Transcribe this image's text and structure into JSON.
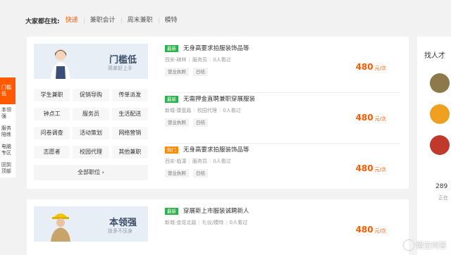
{
  "search": {
    "label": "大家都在找:",
    "keywords": [
      "快递",
      "兼职会计",
      "周末兼职",
      "模特"
    ]
  },
  "leftnav": [
    "门槛低",
    "本领强",
    "服务 陪练",
    "电脑 专区",
    "回到 顶部"
  ],
  "blocks": [
    {
      "banner_title": "门槛低",
      "banner_sub": "简单好上手",
      "categories": [
        "学生兼职",
        "促销导购",
        "传单派发",
        "钟点工",
        "服务员",
        "生活配送",
        "问卷调查",
        "活动策划",
        "网络营销",
        "志愿者",
        "校园代理",
        "其他兼职"
      ],
      "all_label": "全部职位 ›",
      "jobs": [
        {
          "tag": "最新",
          "title": "无身高要求拍服装饰品等",
          "location": "西安-碑林",
          "type": "服务员",
          "views": "0人看过",
          "badges": [
            "营业执照",
            "日结"
          ],
          "price": "480",
          "unit": "元/次"
        },
        {
          "tag": "最新",
          "title": "无需押金直聘兼职穿展服装",
          "location": "新城-康复路",
          "type": "校园代理",
          "views": "0人看过",
          "badges": [
            "营业执照",
            "日结"
          ],
          "price": "480",
          "unit": "元/次"
        },
        {
          "tag": "热门",
          "title": "无身高要求拍服装饰品等",
          "location": "西安-临潼",
          "type": "服务员",
          "views": "0人看过",
          "badges": [
            "营业执照",
            "日结"
          ],
          "price": "480",
          "unit": "元/次"
        }
      ]
    },
    {
      "banner_title": "本领强",
      "banner_sub": "技多不压身",
      "jobs": [
        {
          "tag": "最新",
          "title": "穿展新上市服装诚聘新人",
          "location": "新城-金花北路",
          "type": "礼仪/模特",
          "views": "0人看过",
          "price": "480",
          "unit": "元/次"
        }
      ]
    }
  ],
  "right": {
    "title": "找人才",
    "count": "289",
    "status": "正在"
  },
  "watermark": "悟空问答",
  "colors": {
    "accent": "#ff5a00",
    "new_tag": "#2bb24c",
    "hot_tag": "#ff8a00"
  }
}
